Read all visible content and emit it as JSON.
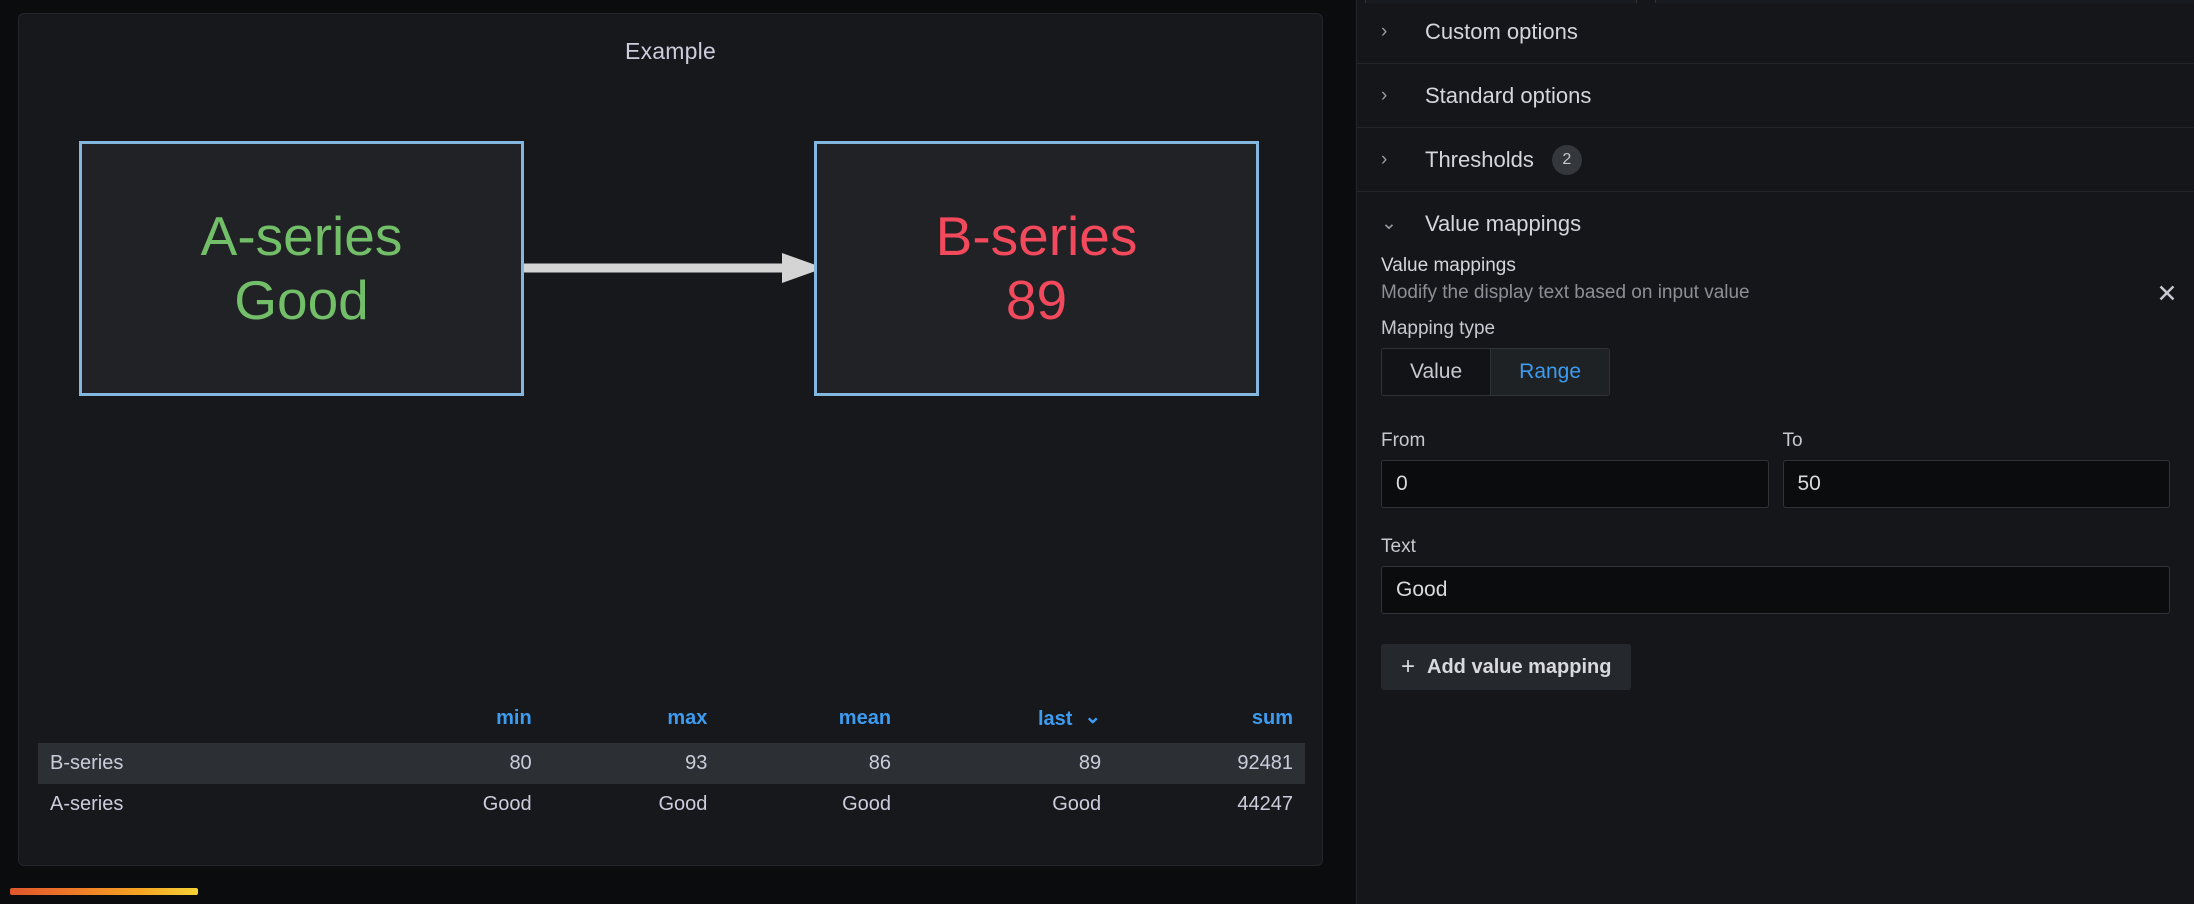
{
  "panel": {
    "title": "Example",
    "nodes": [
      {
        "id": "a",
        "title": "A-series",
        "value": "Good",
        "color": "#73bf69",
        "border_color": "#83b7e0"
      },
      {
        "id": "b",
        "title": "B-series",
        "value": "89",
        "color": "#f2495c",
        "border_color": "#83b7e0"
      }
    ],
    "edge": {
      "from": "a",
      "to": "b",
      "color": "#d4d4d4",
      "icon": "arrow-right-icon"
    }
  },
  "legend": {
    "columns": [
      "",
      "min",
      "max",
      "mean",
      "last",
      "sum"
    ],
    "sorted_column": "last",
    "sort_caret": "⌄",
    "rows": [
      {
        "series": "B-series",
        "min": "80",
        "max": "93",
        "mean": "86",
        "last": "89",
        "sum": "92481",
        "highlighted": true
      },
      {
        "series": "A-series",
        "min": "Good",
        "max": "Good",
        "mean": "Good",
        "last": "Good",
        "sum": "44247",
        "highlighted": false
      }
    ]
  },
  "sidebar": {
    "sections": [
      {
        "key": "custom",
        "title": "Custom options",
        "expanded": false,
        "chevron": "chevron-right-icon",
        "glyph": "›"
      },
      {
        "key": "standard",
        "title": "Standard options",
        "expanded": false,
        "chevron": "chevron-right-icon",
        "glyph": "›"
      },
      {
        "key": "thresholds",
        "title": "Thresholds",
        "expanded": false,
        "chevron": "chevron-right-icon",
        "glyph": "›",
        "badge": "2"
      },
      {
        "key": "value_mappings",
        "title": "Value mappings",
        "expanded": true,
        "chevron": "chevron-down-icon",
        "glyph": "⌄"
      }
    ],
    "value_mappings": {
      "field_label": "Value mappings",
      "field_description": "Modify the display text based on input value",
      "mapping_type_label": "Mapping type",
      "mapping_types": [
        "Value",
        "Range"
      ],
      "mapping_type_selected": "Range",
      "close_label": "✕",
      "from_label": "From",
      "from_value": "0",
      "to_label": "To",
      "to_value": "50",
      "text_label": "Text",
      "text_value": "Good",
      "add_button_label": "Add value mapping",
      "add_button_plus": "+"
    }
  },
  "colors": {
    "accent_blue": "#3d9bf0",
    "green": "#73bf69",
    "red": "#f2495c",
    "node_border": "#83b7e0",
    "panel_bg": "#16181b",
    "sidebar_bg": "#141619"
  }
}
